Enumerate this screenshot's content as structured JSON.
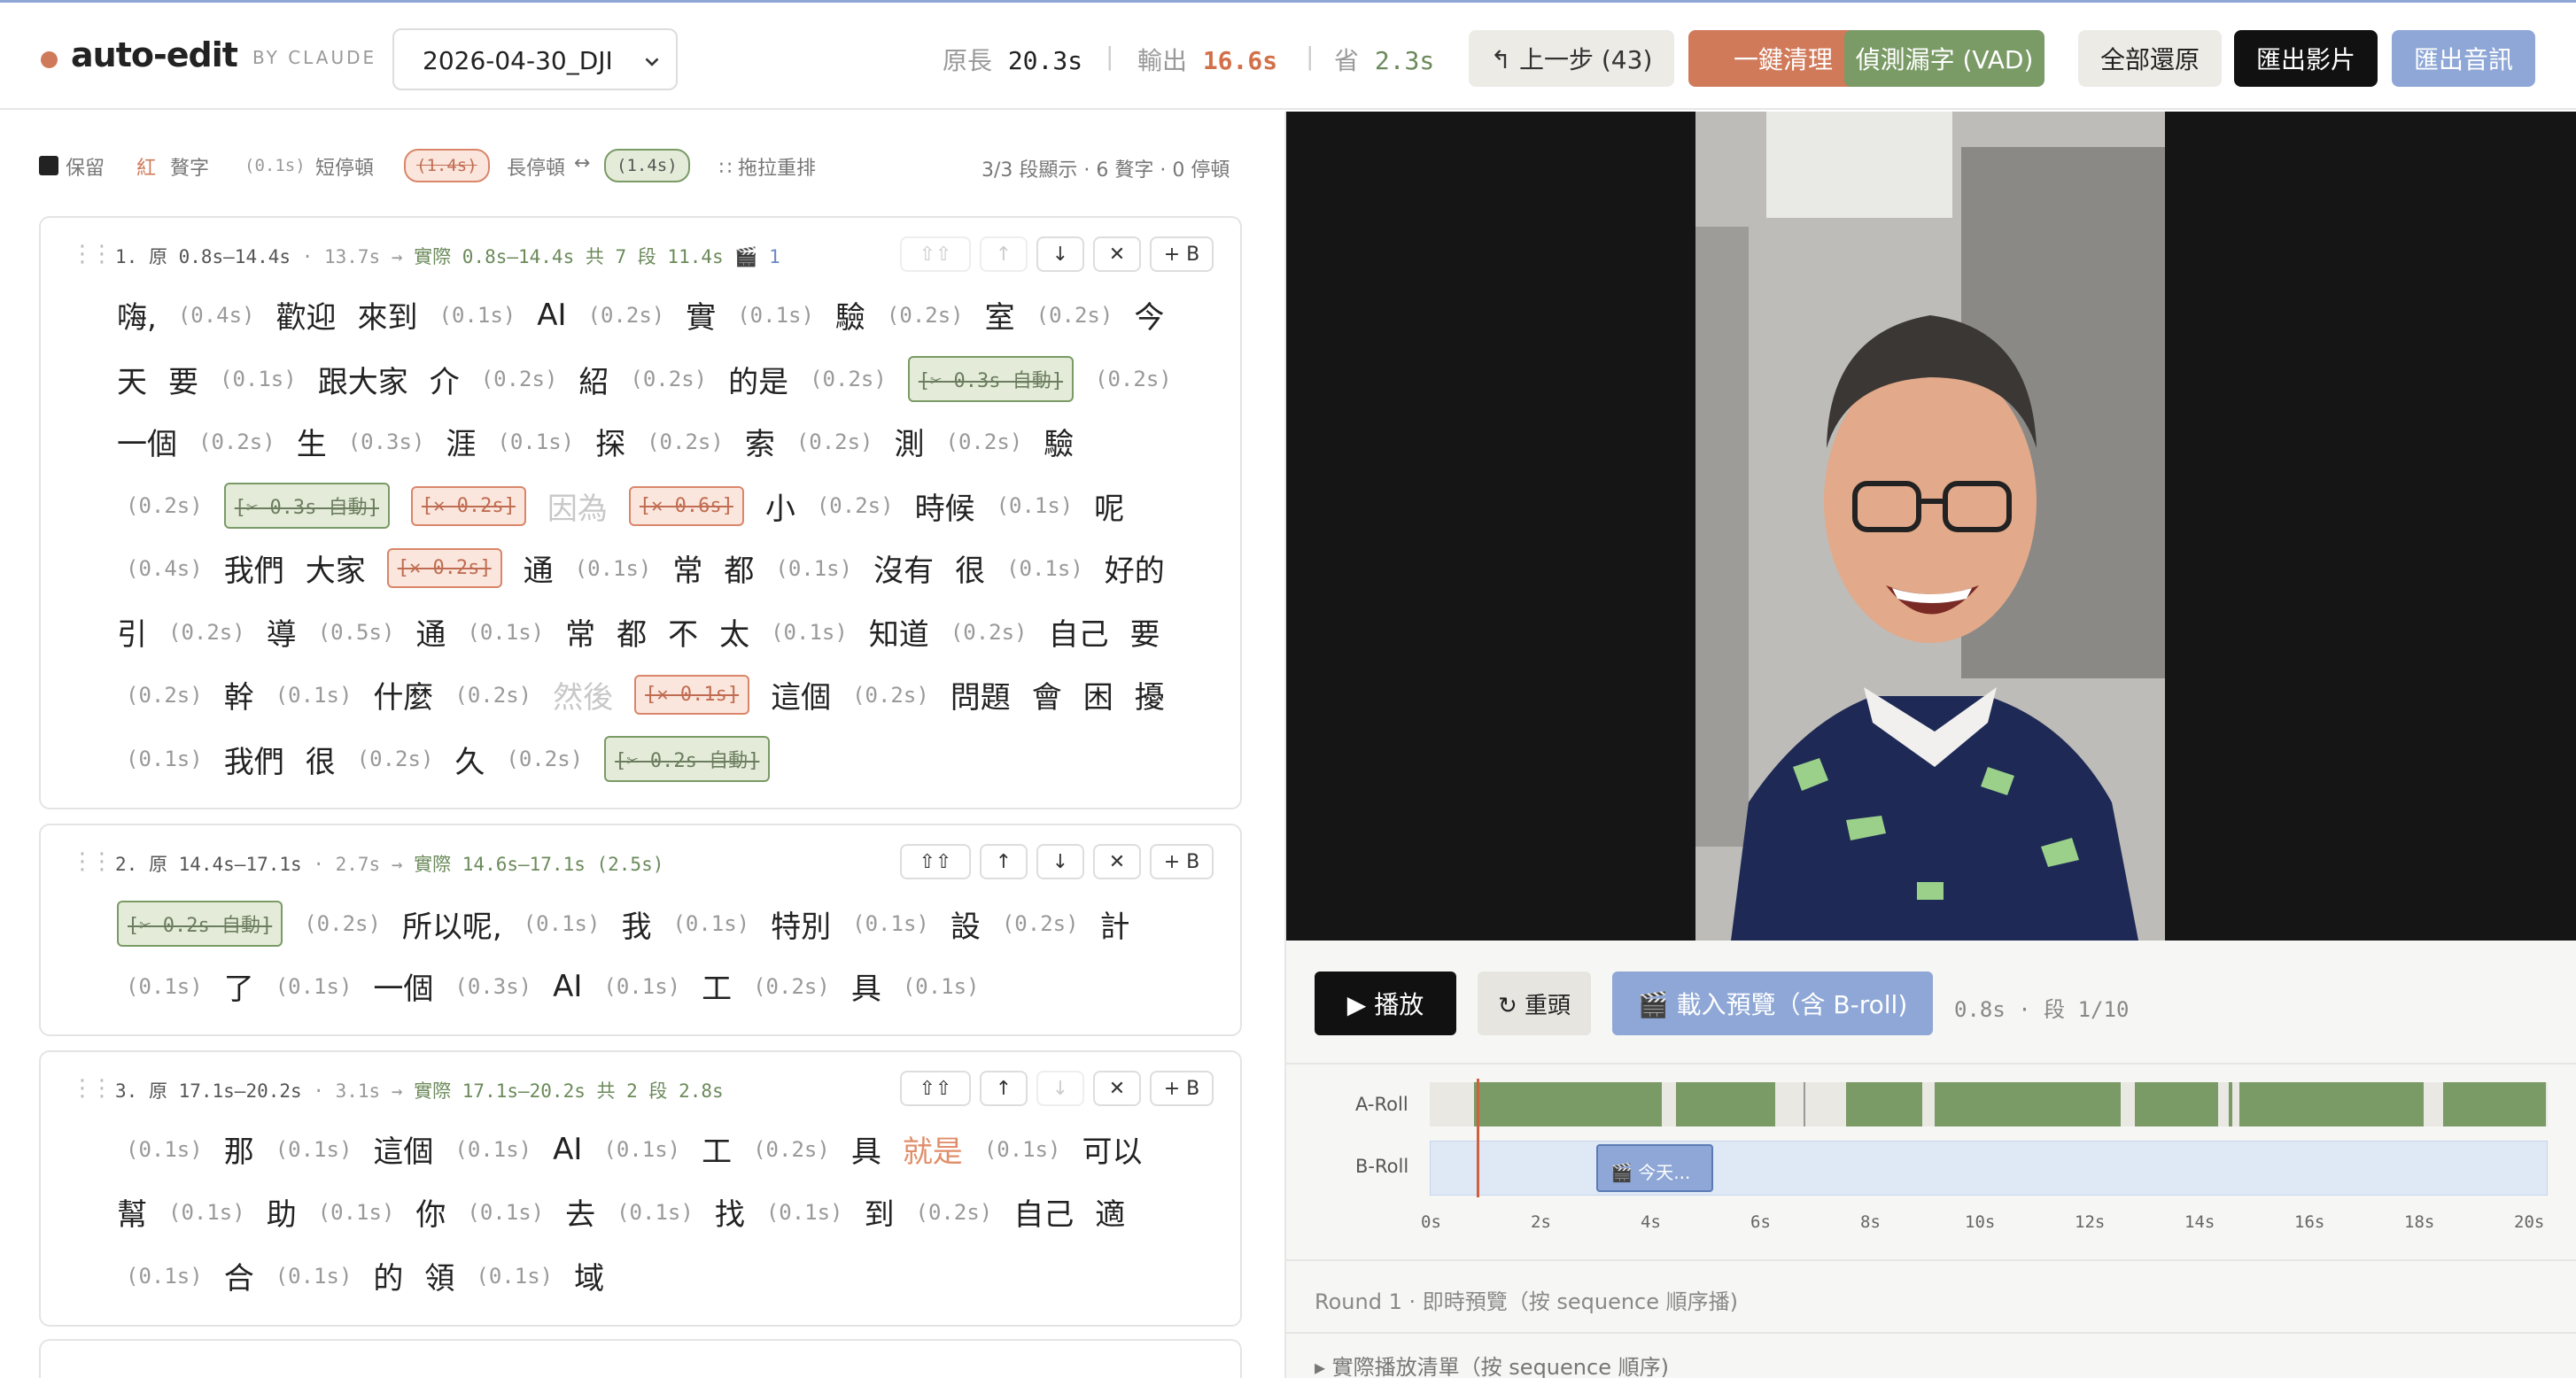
{
  "app": {
    "logo": "auto-edit",
    "byline": "BY CLAUDE",
    "project": "2026-04-30_DJI"
  },
  "stats": {
    "orig_label": "原長",
    "orig_value": "20.3s",
    "out_label": "輸出",
    "out_value": "16.6s",
    "save_label": "省",
    "save_value": "2.3s"
  },
  "toolbar": {
    "undo": "↰ 上一步 (43)",
    "clean": "一鍵清理",
    "vad": "偵測漏字 (VAD)",
    "restore": "全部還原",
    "export_video": "匯出影片",
    "export_audio": "匯出音訊"
  },
  "legend": {
    "keep": "保留",
    "red": "紅",
    "filler": "贅字",
    "short_sample": "(0.1s)",
    "short": "短停頓",
    "long_sample": "(1.4s)",
    "long": "長停頓",
    "arrow": "↔",
    "restored_sample": "(1.4s)",
    "drag": "∷ 拖拉重排",
    "summary": "3/3 段顯示 · 6 贅字 · 0 停頓"
  },
  "segments": [
    {
      "num": "1.",
      "orig": "原 0.8s–14.4s",
      "dur": "· 13.7s →",
      "actual": "實際 0.8s–14.4s 共 7 段 11.4s",
      "clip": "🎬",
      "clip_count": "1",
      "lines": [
        [
          [
            "w",
            "嗨,"
          ],
          [
            "p",
            "(0.4s)"
          ],
          [
            "w",
            "歡迎"
          ],
          [
            "w",
            "來到"
          ],
          [
            "p",
            "(0.1s)"
          ],
          [
            "w",
            "AI"
          ],
          [
            "p",
            "(0.2s)"
          ],
          [
            "w",
            "實"
          ],
          [
            "p",
            "(0.1s)"
          ],
          [
            "w",
            "驗"
          ],
          [
            "p",
            "(0.2s)"
          ],
          [
            "w",
            "室"
          ],
          [
            "p",
            "(0.2s)"
          ],
          [
            "w",
            "今"
          ]
        ],
        [
          [
            "w",
            "天"
          ],
          [
            "w",
            "要"
          ],
          [
            "p",
            "(0.1s)"
          ],
          [
            "w",
            "跟大家"
          ],
          [
            "w",
            "介"
          ],
          [
            "p",
            "(0.2s)"
          ],
          [
            "w",
            "紹"
          ],
          [
            "p",
            "(0.2s)"
          ],
          [
            "w",
            "的是"
          ],
          [
            "p",
            "(0.2s)"
          ],
          [
            "g",
            "[✂ 0.3s 自動]"
          ],
          [
            "p",
            "(0.2s)"
          ]
        ],
        [
          [
            "w",
            "一個"
          ],
          [
            "p",
            "(0.2s)"
          ],
          [
            "w",
            "生"
          ],
          [
            "p",
            "(0.3s)"
          ],
          [
            "w",
            "涯"
          ],
          [
            "p",
            "(0.1s)"
          ],
          [
            "w",
            "探"
          ],
          [
            "p",
            "(0.2s)"
          ],
          [
            "w",
            "索"
          ],
          [
            "p",
            "(0.2s)"
          ],
          [
            "w",
            "測"
          ],
          [
            "p",
            "(0.2s)"
          ],
          [
            "w",
            "驗"
          ]
        ],
        [
          [
            "p",
            "(0.2s)"
          ],
          [
            "g",
            "[✂ 0.3s 自動]"
          ],
          [
            "r",
            "[✕ 0.2s]"
          ],
          [
            "x",
            "因為"
          ],
          [
            "r",
            "[✕ 0.6s]"
          ],
          [
            "w",
            "小"
          ],
          [
            "p",
            "(0.2s)"
          ],
          [
            "w",
            "時候"
          ],
          [
            "p",
            "(0.1s)"
          ],
          [
            "w",
            "呢"
          ]
        ],
        [
          [
            "p",
            "(0.4s)"
          ],
          [
            "w",
            "我們"
          ],
          [
            "w",
            "大家"
          ],
          [
            "r",
            "[✕ 0.2s]"
          ],
          [
            "w",
            "通"
          ],
          [
            "p",
            "(0.1s)"
          ],
          [
            "w",
            "常"
          ],
          [
            "w",
            "都"
          ],
          [
            "p",
            "(0.1s)"
          ],
          [
            "w",
            "沒有"
          ],
          [
            "w",
            "很"
          ],
          [
            "p",
            "(0.1s)"
          ],
          [
            "w",
            "好的"
          ]
        ],
        [
          [
            "w",
            "引"
          ],
          [
            "p",
            "(0.2s)"
          ],
          [
            "w",
            "導"
          ],
          [
            "p",
            "(0.5s)"
          ],
          [
            "w",
            "通"
          ],
          [
            "p",
            "(0.1s)"
          ],
          [
            "w",
            "常"
          ],
          [
            "w",
            "都"
          ],
          [
            "w",
            "不"
          ],
          [
            "w",
            "太"
          ],
          [
            "p",
            "(0.1s)"
          ],
          [
            "w",
            "知道"
          ],
          [
            "p",
            "(0.2s)"
          ],
          [
            "w",
            "自己"
          ],
          [
            "w",
            "要"
          ]
        ],
        [
          [
            "p",
            "(0.2s)"
          ],
          [
            "w",
            "幹"
          ],
          [
            "p",
            "(0.1s)"
          ],
          [
            "w",
            "什麼"
          ],
          [
            "p",
            "(0.2s)"
          ],
          [
            "x",
            "然後"
          ],
          [
            "r",
            "[✕ 0.1s]"
          ],
          [
            "w",
            "這個"
          ],
          [
            "p",
            "(0.2s)"
          ],
          [
            "w",
            "問題"
          ],
          [
            "w",
            "會"
          ],
          [
            "w",
            "困"
          ],
          [
            "w",
            "擾"
          ]
        ],
        [
          [
            "p",
            "(0.1s)"
          ],
          [
            "w",
            "我們"
          ],
          [
            "w",
            "很"
          ],
          [
            "p",
            "(0.2s)"
          ],
          [
            "w",
            "久"
          ],
          [
            "p",
            "(0.2s)"
          ],
          [
            "g",
            "[✂ 0.2s 自動]"
          ]
        ]
      ]
    },
    {
      "num": "2.",
      "orig": "原 14.4s–17.1s",
      "dur": "· 2.7s →",
      "actual": "實際 14.6s–17.1s (2.5s)",
      "lines": [
        [
          [
            "g",
            "[✂ 0.2s 自動]"
          ],
          [
            "p",
            "(0.2s)"
          ],
          [
            "w",
            "所以呢,"
          ],
          [
            "p",
            "(0.1s)"
          ],
          [
            "w",
            "我"
          ],
          [
            "p",
            "(0.1s)"
          ],
          [
            "w",
            "特別"
          ],
          [
            "p",
            "(0.1s)"
          ],
          [
            "w",
            "設"
          ],
          [
            "p",
            "(0.2s)"
          ],
          [
            "w",
            "計"
          ]
        ],
        [
          [
            "p",
            "(0.1s)"
          ],
          [
            "w",
            "了"
          ],
          [
            "p",
            "(0.1s)"
          ],
          [
            "w",
            "一個"
          ],
          [
            "p",
            "(0.3s)"
          ],
          [
            "w",
            "AI"
          ],
          [
            "p",
            "(0.1s)"
          ],
          [
            "w",
            "工"
          ],
          [
            "p",
            "(0.2s)"
          ],
          [
            "w",
            "具"
          ],
          [
            "p",
            "(0.1s)"
          ]
        ]
      ]
    },
    {
      "num": "3.",
      "orig": "原 17.1s–20.2s",
      "dur": "· 3.1s →",
      "actual": "實際 17.1s–20.2s 共 2 段 2.8s",
      "lines": [
        [
          [
            "p",
            "(0.1s)"
          ],
          [
            "w",
            "那"
          ],
          [
            "p",
            "(0.1s)"
          ],
          [
            "w",
            "這個"
          ],
          [
            "p",
            "(0.1s)"
          ],
          [
            "w",
            "AI"
          ],
          [
            "p",
            "(0.1s)"
          ],
          [
            "w",
            "工"
          ],
          [
            "p",
            "(0.2s)"
          ],
          [
            "w",
            "具"
          ],
          [
            "o",
            "就是"
          ],
          [
            "p",
            "(0.1s)"
          ],
          [
            "w",
            "可以"
          ]
        ],
        [
          [
            "w",
            "幫"
          ],
          [
            "p",
            "(0.1s)"
          ],
          [
            "w",
            "助"
          ],
          [
            "p",
            "(0.1s)"
          ],
          [
            "w",
            "你"
          ],
          [
            "p",
            "(0.1s)"
          ],
          [
            "w",
            "去"
          ],
          [
            "p",
            "(0.1s)"
          ],
          [
            "w",
            "找"
          ],
          [
            "p",
            "(0.1s)"
          ],
          [
            "w",
            "到"
          ],
          [
            "p",
            "(0.2s)"
          ],
          [
            "w",
            "自己"
          ],
          [
            "w",
            "適"
          ]
        ],
        [
          [
            "p",
            "(0.1s)"
          ],
          [
            "w",
            "合"
          ],
          [
            "p",
            "(0.1s)"
          ],
          [
            "w",
            "的"
          ],
          [
            "w",
            "領"
          ],
          [
            "p",
            "(0.1s)"
          ],
          [
            "w",
            "域"
          ]
        ]
      ]
    }
  ],
  "controls": {
    "top": "⇧⇧",
    "up": "↑",
    "down": "↓",
    "del": "✕",
    "addb": "+ B"
  },
  "player": {
    "play": "▶ 播放",
    "restart": "↻ 重頭",
    "preview": "🎬 載入預覽（含 B-roll)",
    "position": "0.8s · 段 1/10"
  },
  "timeline": {
    "a_label": "A-Roll",
    "b_label": "B-Roll",
    "b_clip": "🎬 今天...",
    "ticks": [
      "0s",
      "2s",
      "4s",
      "6s",
      "8s",
      "10s",
      "12s",
      "14s",
      "16s",
      "18s",
      "20s"
    ]
  },
  "footer": {
    "round": "Round 1 · 即時預覽（按 sequence 順序播)",
    "list": "▸ 實際播放清單（按 sequence 順序)"
  }
}
